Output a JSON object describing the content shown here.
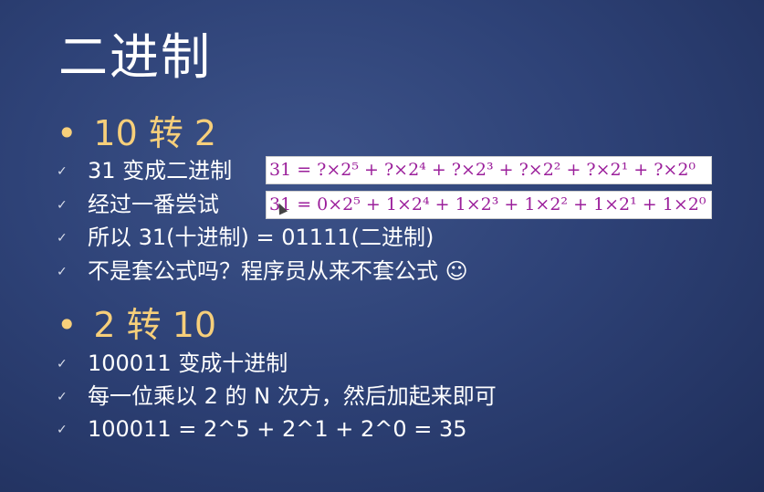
{
  "slide": {
    "title": "二进制",
    "sections": [
      {
        "bullet": "•",
        "heading": "10 转 2",
        "items": [
          {
            "check": "✓",
            "text": "31 变成二进制",
            "formula": "31 = ?×2⁵ + ?×2⁴ + ?×2³ + ?×2² + ?×2¹ + ?×2⁰"
          },
          {
            "check": "✓",
            "text": "经过一番尝试",
            "formula": "31 = 0×2⁵ + 1×2⁴ + 1×2³ + 1×2² + 1×2¹ + 1×2⁰"
          },
          {
            "check": "✓",
            "text": "所以 31(十进制) = 01111(二进制)"
          },
          {
            "check": "✓",
            "text": "不是套公式吗？程序员从来不套公式 ☺"
          }
        ]
      },
      {
        "bullet": "•",
        "heading": "2 转 10",
        "items": [
          {
            "check": "✓",
            "text": "100011 变成十进制"
          },
          {
            "check": "✓",
            "text": "每一位乘以 2 的 N 次方，然后加起来即可"
          },
          {
            "check": "✓",
            "text": "100011 = 2^5 + 2^1 + 2^0 = 35"
          }
        ]
      }
    ]
  }
}
